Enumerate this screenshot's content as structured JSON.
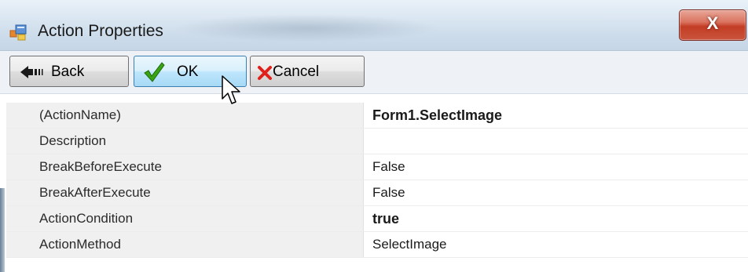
{
  "window": {
    "title": "Action Properties",
    "close_label": "X"
  },
  "toolbar": {
    "back_label": "Back",
    "ok_label": "OK",
    "cancel_label": "Cancel"
  },
  "properties": [
    {
      "name": "(ActionName)",
      "value": "Form1.SelectImage",
      "bold": true
    },
    {
      "name": "Description",
      "value": "",
      "bold": false
    },
    {
      "name": "BreakBeforeExecute",
      "value": "False",
      "bold": false
    },
    {
      "name": "BreakAfterExecute",
      "value": "False",
      "bold": false
    },
    {
      "name": "ActionCondition",
      "value": "true",
      "bold": true
    },
    {
      "name": "ActionMethod",
      "value": "SelectImage",
      "bold": false
    }
  ],
  "icons": {
    "app": "form-icon",
    "back": "back-arrow-icon",
    "ok": "checkmark-icon",
    "cancel": "cross-icon",
    "close": "close-icon",
    "pointer": "mouse-pointer-icon"
  },
  "colors": {
    "ok_check": "#3aa312",
    "cancel_cross": "#e0201b",
    "close_button": "#c43d25"
  }
}
